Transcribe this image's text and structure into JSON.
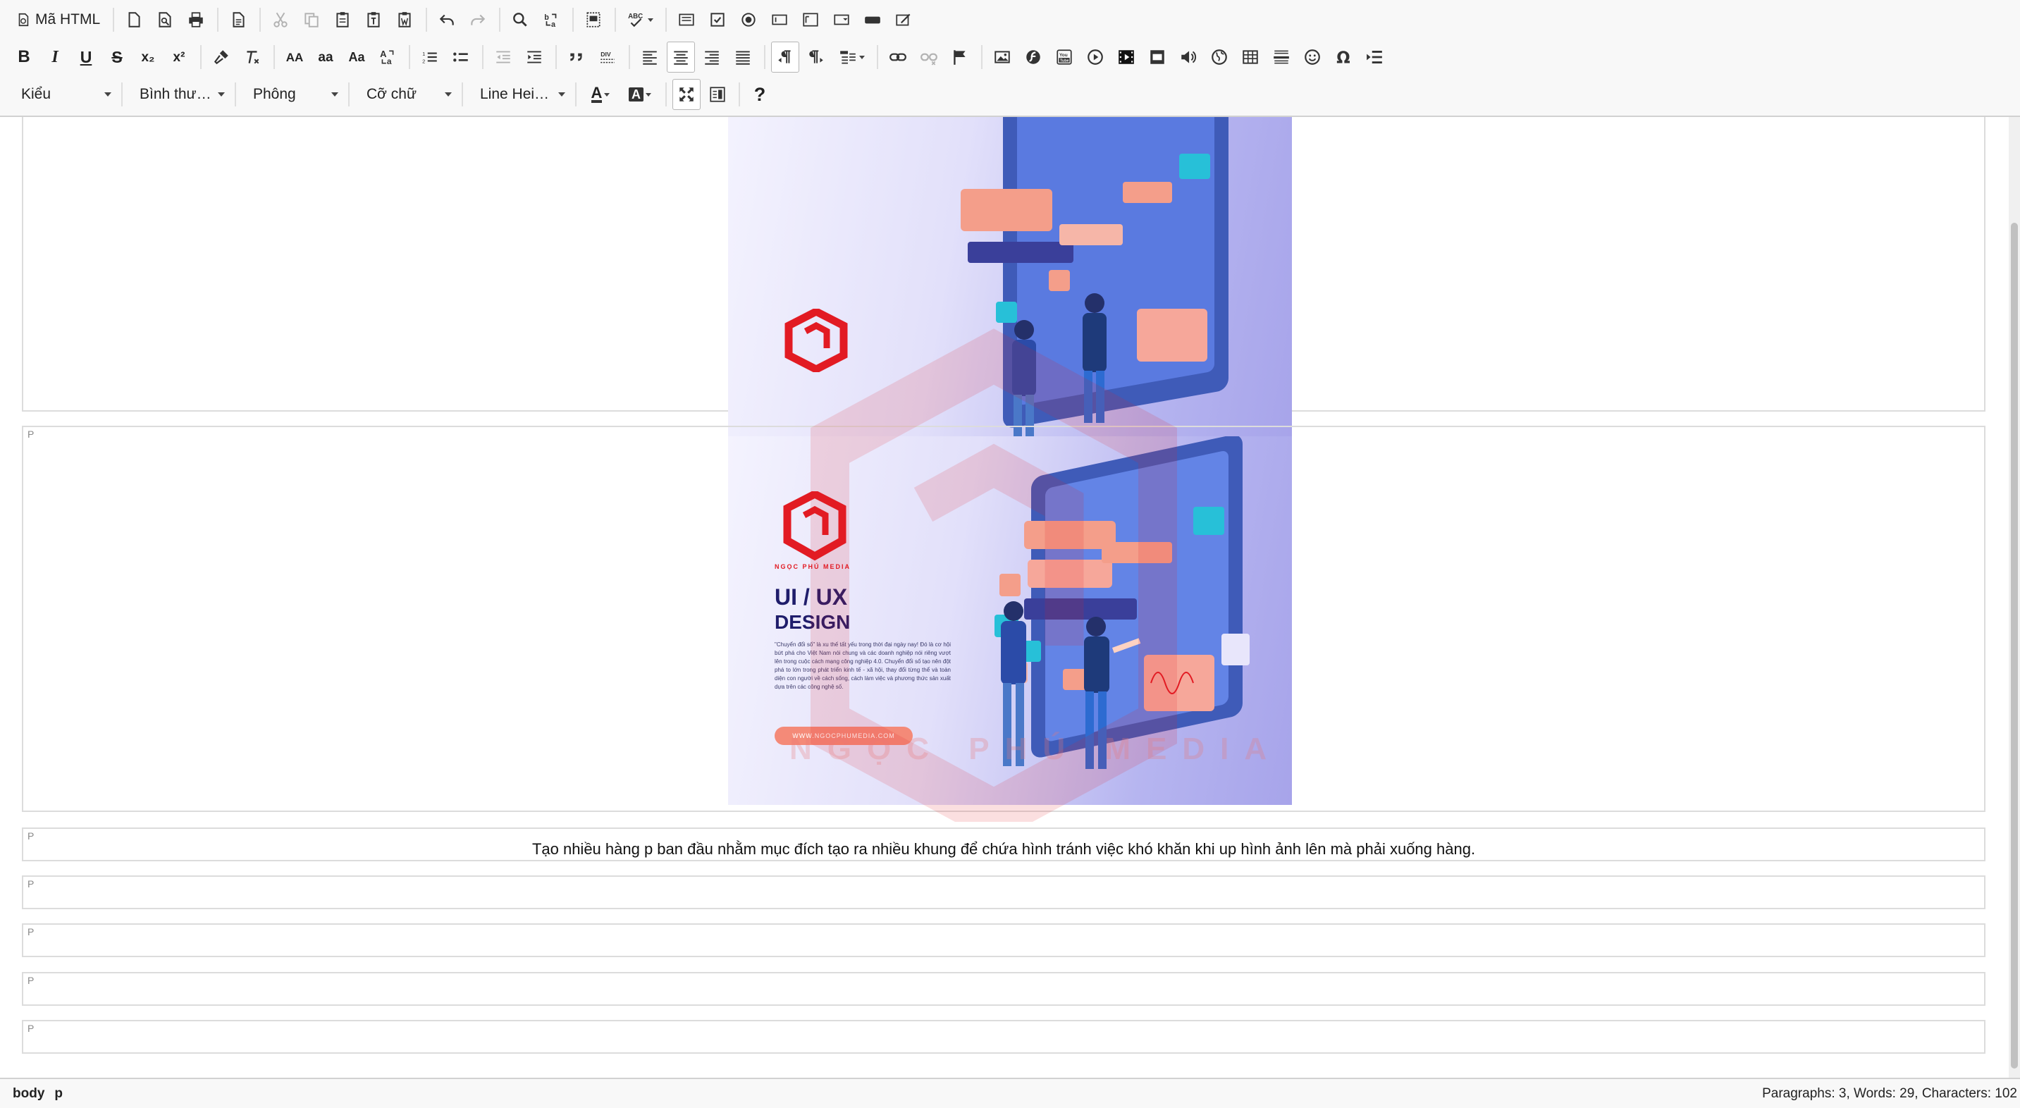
{
  "toolbar": {
    "source_label": "Mã HTML",
    "bold_glyph": "B",
    "italic_glyph": "I",
    "underline_glyph": "U",
    "strike_glyph": "S",
    "subscript_glyph": "x₂",
    "superscript_glyph": "x²",
    "uppercase_glyph": "AA",
    "lowercase_glyph": "aa",
    "capitalize_glyph": "Aa",
    "help_glyph": "?",
    "style_dropdown": "Kiểu",
    "format_dropdown": "Bình thư…",
    "font_dropdown": "Phông",
    "size_dropdown": "Cỡ chữ",
    "lineheight_dropdown": "Line Hei…",
    "text_color_glyph": "A",
    "bg_color_glyph": "A"
  },
  "content": {
    "p_tag": "P",
    "paragraph_text": "Tạo nhiều hàng p ban đầu nhằm mục đích tạo ra nhiều khung để chứa hình tránh việc khó khăn khi up hình ảnh lên mà phải xuống hàng.",
    "banner": {
      "brand": "NGỌC PHÚ MEDIA",
      "title_line1": "UI / UX",
      "title_line2": "DESIGN",
      "body": "\"Chuyển đổi số\" là xu thế tất yếu trong thời đại ngày nay! Đó là cơ hội bứt phá cho Việt Nam nói chung và các doanh nghiệp nói riêng vượt lên trong cuộc cách mạng công nghiệp 4.0. Chuyển đổi số tạo nên đột phá to lớn trong phát triển kinh tế - xã hội, thay đổi từng thể và toàn diện con người về cách sống, cách làm việc và phương thức sản xuất dựa trên các công nghệ số.",
      "url": "WWW.NGOCPHUMEDIA.COM"
    },
    "watermark_text": "NGỌC PHÚ MEDIA"
  },
  "statusbar": {
    "crumbs": [
      "body",
      "p"
    ],
    "stats": "Paragraphs: 3, Words: 29, Characters: 102"
  },
  "colors": {
    "brand_red": "#e21b23",
    "accent_navy": "#1f1d6b",
    "button_salmon": "#f48a78",
    "toolbar_bg": "#f8f8f8"
  }
}
